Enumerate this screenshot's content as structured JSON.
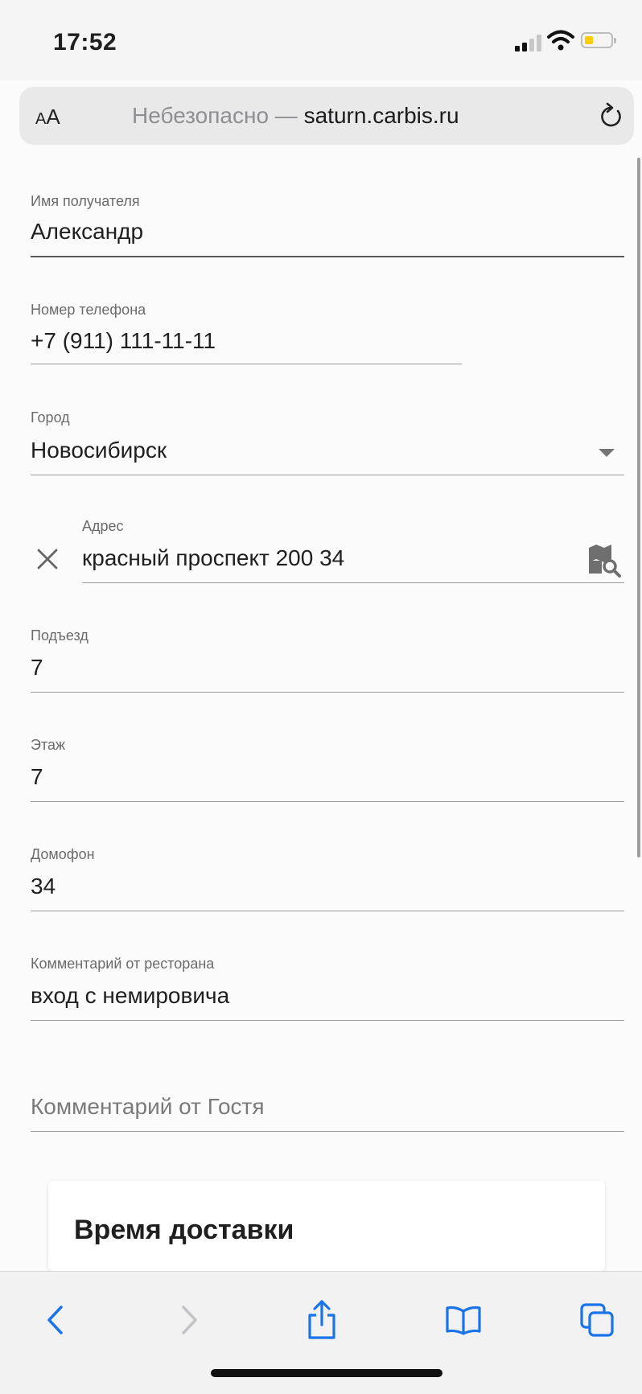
{
  "status_bar": {
    "time": "17:52"
  },
  "url_bar": {
    "aa_label_small": "A",
    "aa_label_large": "A",
    "security_text": "Небезопасно — ",
    "host": "saturn.carbis.ru"
  },
  "form": {
    "recipient_name": {
      "label": "Имя получателя",
      "value": "Александр"
    },
    "phone": {
      "label": "Номер телефона",
      "value": "+7 (911) 111-11-11"
    },
    "city": {
      "label": "Город",
      "value": "Новосибирск"
    },
    "address": {
      "label": "Адрес",
      "value": "красный проспект 200 34"
    },
    "entrance": {
      "label": "Подъезд",
      "value": "7"
    },
    "floor": {
      "label": "Этаж",
      "value": "7"
    },
    "intercom": {
      "label": "Домофон",
      "value": "34"
    },
    "restaurant_comment": {
      "label": "Комментарий от ресторана",
      "value": "вход с немировича"
    },
    "guest_comment": {
      "placeholder": "Комментарий от Гостя"
    }
  },
  "delivery_card": {
    "title": "Время доставки"
  },
  "toolbar": {
    "icons": [
      "back-icon",
      "forward-icon",
      "share-icon",
      "bookmarks-icon",
      "tabs-icon"
    ]
  },
  "colors": {
    "ios_blue": "#1a73e8",
    "battery_low": "#ffcc00"
  }
}
